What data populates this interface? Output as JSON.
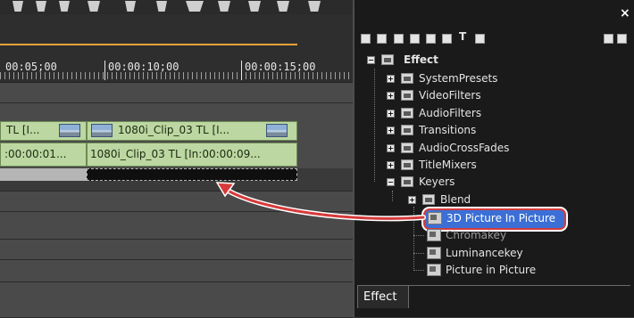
{
  "timeline": {
    "timecodes": [
      "00:05;00",
      "00:00:10;00",
      "00:00:15;00"
    ],
    "video_clip_1": "TL [I...",
    "video_clip_2": "1080i_Clip_03  TL [I...",
    "audio_clip_1": ":00:00:01...",
    "audio_clip_2": "1080i_Clip_03  TL [In:00:00:09..."
  },
  "effect_panel": {
    "close_label": "×",
    "tab_label": "Effect",
    "tree": {
      "root": "Effect",
      "children": [
        {
          "label": "SystemPresets"
        },
        {
          "label": "VideoFilters"
        },
        {
          "label": "AudioFilters"
        },
        {
          "label": "Transitions"
        },
        {
          "label": "AudioCrossFades"
        },
        {
          "label": "TitleMixers"
        },
        {
          "label": "Keyers"
        }
      ],
      "keyers_children": [
        {
          "label": "Blend"
        },
        {
          "label": "3D Picture In Picture",
          "selected": true
        },
        {
          "label": "Chromakey"
        },
        {
          "label": "Luminancekey"
        },
        {
          "label": "Picture in Picture"
        }
      ]
    }
  },
  "colors": {
    "clip_fill": "#bcd7a1",
    "selection": "#3b6fd6",
    "highlight_ring": "#d63a3a",
    "ruler_line": "#e8a33a"
  }
}
